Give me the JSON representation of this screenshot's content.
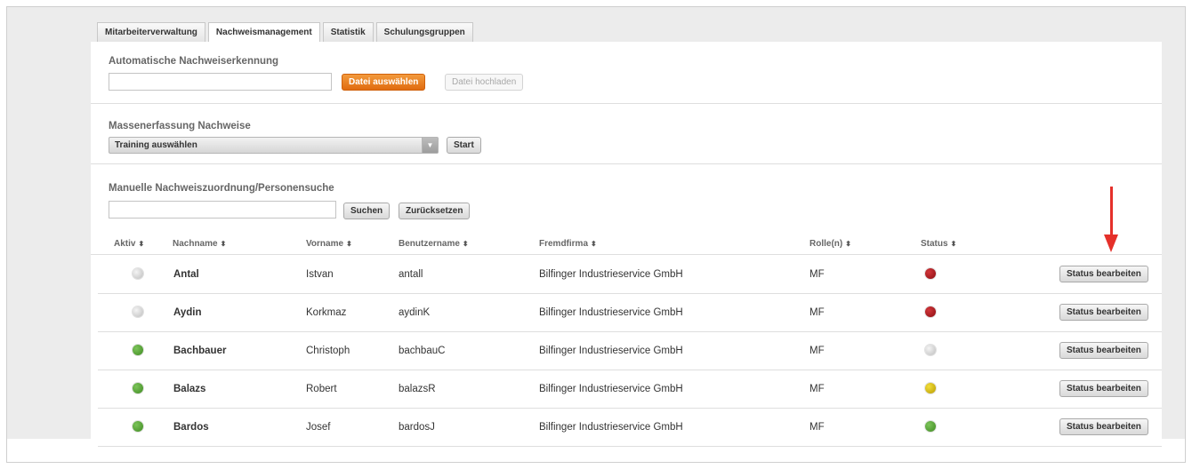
{
  "tabs": [
    {
      "label": "Mitarbeiterverwaltung",
      "active": false
    },
    {
      "label": "Nachweismanagement",
      "active": true
    },
    {
      "label": "Statistik",
      "active": false
    },
    {
      "label": "Schulungsgruppen",
      "active": false
    }
  ],
  "auto_section": {
    "title": "Automatische Nachweiserkennung",
    "input_value": "",
    "select_file_label": "Datei auswählen",
    "upload_label": "Datei hochladen"
  },
  "mass_section": {
    "title": "Massenerfassung Nachweise",
    "select_value": "Training auswählen",
    "start_label": "Start"
  },
  "manual_section": {
    "title": "Manuelle Nachweiszuordnung/Personensuche",
    "input_value": "",
    "search_label": "Suchen",
    "reset_label": "Zurücksetzen"
  },
  "table": {
    "columns": [
      "Aktiv",
      "Nachname",
      "Vorname",
      "Benutzername",
      "Fremdfirma",
      "Rolle(n)",
      "Status"
    ],
    "rows": [
      {
        "aktiv": "grey",
        "nachname": "Antal",
        "vorname": "Istvan",
        "benutzername": "antall",
        "fremdfirma": "Bilfinger Industrieservice GmbH",
        "rolle": "MF",
        "status": "red",
        "action": "Status bearbeiten"
      },
      {
        "aktiv": "grey",
        "nachname": "Aydin",
        "vorname": "Korkmaz",
        "benutzername": "aydinK",
        "fremdfirma": "Bilfinger Industrieservice GmbH",
        "rolle": "MF",
        "status": "red",
        "action": "Status bearbeiten"
      },
      {
        "aktiv": "green",
        "nachname": "Bachbauer",
        "vorname": "Christoph",
        "benutzername": "bachbauC",
        "fremdfirma": "Bilfinger Industrieservice GmbH",
        "rolle": "MF",
        "status": "grey",
        "action": "Status bearbeiten"
      },
      {
        "aktiv": "green",
        "nachname": "Balazs",
        "vorname": "Robert",
        "benutzername": "balazsR",
        "fremdfirma": "Bilfinger Industrieservice GmbH",
        "rolle": "MF",
        "status": "yellow",
        "action": "Status bearbeiten"
      },
      {
        "aktiv": "green",
        "nachname": "Bardos",
        "vorname": "Josef",
        "benutzername": "bardosJ",
        "fremdfirma": "Bilfinger Industrieservice GmbH",
        "rolle": "MF",
        "status": "green",
        "action": "Status bearbeiten"
      }
    ]
  },
  "colors": {
    "accent_orange": "#e87a1e",
    "dot_green": "#4a9a2c",
    "dot_red": "#a3151b",
    "dot_yellow": "#d4b800",
    "dot_grey": "#cfcfcf",
    "arrow_red": "#e5302a"
  }
}
